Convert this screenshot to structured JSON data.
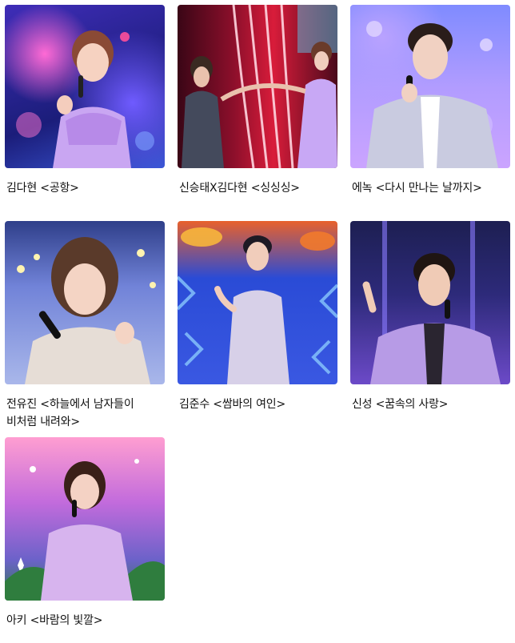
{
  "gallery": {
    "items": [
      {
        "caption": "김다현 <공항>",
        "image": "stage-performance-photo",
        "accent": "#b98bf2"
      },
      {
        "caption": "신승태X김다현 <싱싱싱>",
        "image": "stage-performance-photo",
        "accent": "#c8a8f5"
      },
      {
        "caption": "에녹 <다시 만나는 날까지>",
        "image": "stage-performance-photo",
        "accent": "#c9cbe0"
      },
      {
        "caption": "전유진 <하늘에서 남자들이 비처럼 내려와>",
        "image": "stage-performance-photo",
        "accent": "#e6ddd6"
      },
      {
        "caption": "김준수 <쌈바의 여인>",
        "image": "stage-performance-photo",
        "accent": "#d7d0e8"
      },
      {
        "caption": "신성 <꿈속의 사랑>",
        "image": "stage-performance-photo",
        "accent": "#b79be6"
      },
      {
        "caption": "아키 <바람의 빛깔>",
        "image": "stage-performance-photo",
        "accent": "#d7b4ee"
      }
    ]
  }
}
